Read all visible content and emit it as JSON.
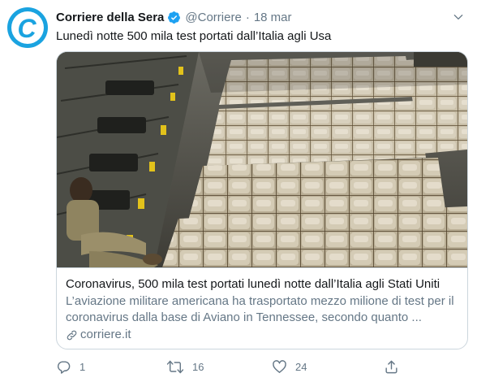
{
  "tweet": {
    "display_name": "Corriere della Sera",
    "handle": "@Corriere",
    "separator": "·",
    "date": "18 mar",
    "avatar_letter": "C",
    "text": "Lunedì notte 500 mila test portati dall’Italia agli Usa"
  },
  "card": {
    "title": "Coronavirus, 500 mila test portati lunedì notte dall’Italia agli Stati Uniti",
    "description": "L’aviazione militare americana ha trasportato mezzo milione di test per il coronavirus dalla base di Aviano in Tennessee, secondo quanto ...",
    "domain": "corriere.it"
  },
  "actions": {
    "reply_count": "1",
    "retweet_count": "16",
    "like_count": "24",
    "share_count": ""
  },
  "colors": {
    "brand": "#1aa3e0",
    "verified": "#1da1f2",
    "secondary_text": "#657786",
    "border": "#ccd6dd"
  },
  "icons": {
    "verified": "verified-badge-icon",
    "more": "chevron-down-icon",
    "link": "link-icon",
    "reply": "reply-icon",
    "retweet": "retweet-icon",
    "like": "heart-icon",
    "share": "share-icon"
  }
}
